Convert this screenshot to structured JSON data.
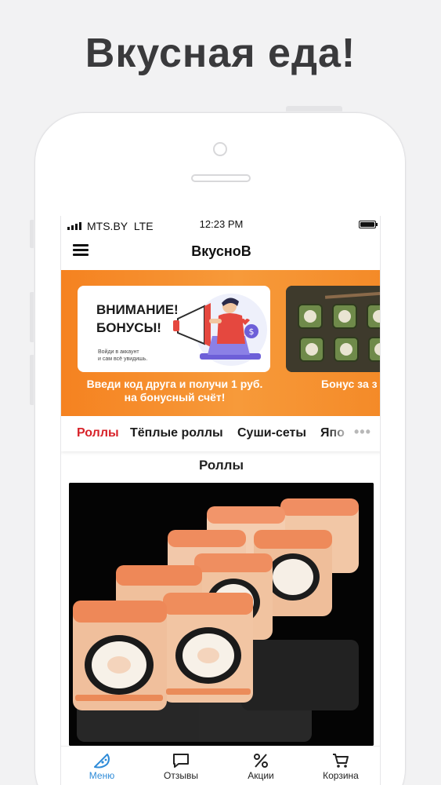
{
  "headline": "Вкусная еда!",
  "status_bar": {
    "carrier": "MTS.BY",
    "network": "LTE",
    "time": "12:23 PM"
  },
  "app_bar": {
    "title": "ВкусноВ"
  },
  "promos": [
    {
      "title": "ВНИМАНИЕ!\nБОНУСЫ!",
      "small_text": "Войди в аккаунт\nи сам всё увидишь.",
      "caption": "Введи код друга и получи 1 руб. на бонусный счёт!"
    },
    {
      "caption": "Бонус за з"
    }
  ],
  "categories": {
    "items": [
      "Роллы",
      "Тёплые роллы",
      "Суши-сеты",
      "Япо"
    ],
    "active": "Роллы",
    "more_icon": "more-dots-icon"
  },
  "section": {
    "title": "Роллы"
  },
  "bottom_nav": {
    "items": [
      {
        "label": "Меню",
        "icon": "pizza-slice-icon"
      },
      {
        "label": "Отзывы",
        "icon": "chat-bubble-icon"
      },
      {
        "label": "Акции",
        "icon": "percent-icon"
      },
      {
        "label": "Корзина",
        "icon": "cart-icon"
      }
    ],
    "active": "Меню"
  },
  "colors": {
    "accent_red": "#d8232a",
    "accent_blue": "#2e8bd8",
    "banner_orange": "#f58220"
  }
}
